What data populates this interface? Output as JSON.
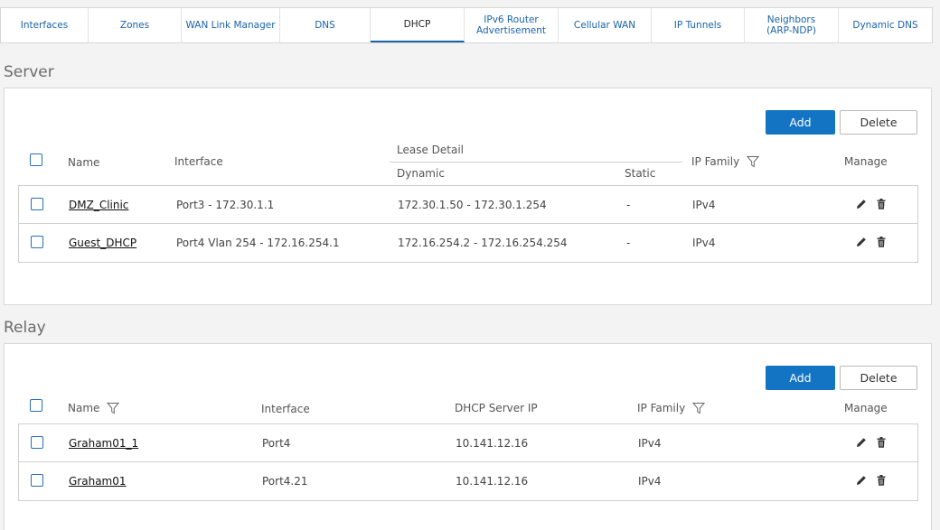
{
  "tabs": [
    {
      "label": "Interfaces",
      "active": false
    },
    {
      "label": "Zones",
      "active": false
    },
    {
      "label": "WAN Link Manager",
      "active": false
    },
    {
      "label": "DNS",
      "active": false
    },
    {
      "label": "DHCP",
      "active": true
    },
    {
      "label": "IPv6 Router Advertisement",
      "active": false
    },
    {
      "label": "Cellular WAN",
      "active": false
    },
    {
      "label": "IP Tunnels",
      "active": false
    },
    {
      "label": "Neighbors (ARP-NDP)",
      "active": false
    },
    {
      "label": "Dynamic DNS",
      "active": false
    }
  ],
  "server": {
    "title": "Server",
    "add_label": "Add",
    "delete_label": "Delete",
    "headers": {
      "name": "Name",
      "interface": "Interface",
      "lease_detail": "Lease Detail",
      "dynamic": "Dynamic",
      "static": "Static",
      "ip_family": "IP Family",
      "manage": "Manage"
    },
    "rows": [
      {
        "name": "DMZ_Clinic",
        "interface": "Port3 - 172.30.1.1",
        "dynamic": "172.30.1.50 - 172.30.1.254",
        "static": "-",
        "ip_family": "IPv4"
      },
      {
        "name": "Guest_DHCP",
        "interface": "Port4 Vlan 254 - 172.16.254.1",
        "dynamic": "172.16.254.2 - 172.16.254.254",
        "static": "-",
        "ip_family": "IPv4"
      }
    ]
  },
  "relay": {
    "title": "Relay",
    "add_label": "Add",
    "delete_label": "Delete",
    "headers": {
      "name": "Name",
      "interface": "Interface",
      "dhcp_server_ip": "DHCP Server IP",
      "ip_family": "IP Family",
      "manage": "Manage"
    },
    "rows": [
      {
        "name": "Graham01_1",
        "interface": "Port4",
        "dhcp_server_ip": "10.141.12.16",
        "ip_family": "IPv4"
      },
      {
        "name": "Graham01",
        "interface": "Port4.21",
        "dhcp_server_ip": "10.141.12.16",
        "ip_family": "IPv4"
      }
    ]
  },
  "colors": {
    "accent": "#1474c4",
    "tab_text": "#1a63a8"
  },
  "icons": {
    "filter": "funnel-icon",
    "edit": "pencil-icon",
    "delete": "trash-icon"
  }
}
